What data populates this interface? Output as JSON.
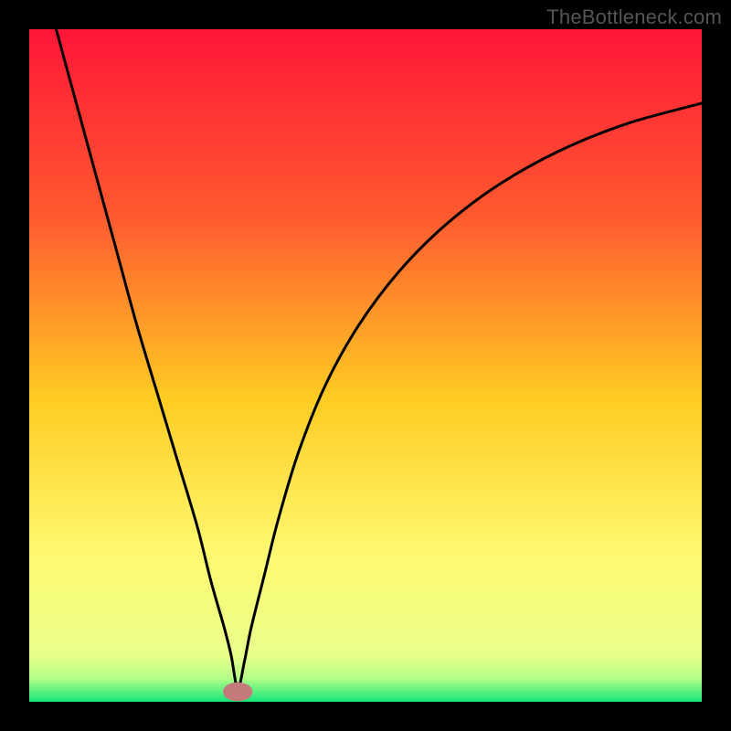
{
  "watermark": "TheBottleneck.com",
  "chart_data": {
    "type": "line",
    "title": "",
    "xlabel": "",
    "ylabel": "",
    "xlim": [
      0,
      100
    ],
    "ylim": [
      0,
      100
    ],
    "grid": false,
    "legend": false,
    "gradient_stops": [
      {
        "offset": 0,
        "color": "#ff1638"
      },
      {
        "offset": 0.28,
        "color": "#ff5a2f"
      },
      {
        "offset": 0.55,
        "color": "#ffcc22"
      },
      {
        "offset": 0.78,
        "color": "#fff970"
      },
      {
        "offset": 0.93,
        "color": "#eaff8a"
      },
      {
        "offset": 0.965,
        "color": "#b3ff88"
      },
      {
        "offset": 1.0,
        "color": "#15e77a"
      }
    ],
    "marker": {
      "x": 31,
      "y": 1.5,
      "rx": 2.2,
      "ry": 1.4,
      "color": "#c47a7a"
    },
    "series": [
      {
        "name": "curve",
        "x": [
          4.0,
          7,
          10,
          13,
          16,
          19,
          22,
          25,
          27,
          29,
          30,
          31,
          32,
          33,
          35,
          37,
          40,
          44,
          49,
          55,
          62,
          70,
          79,
          89,
          100
        ],
        "values": [
          100,
          89,
          78,
          67,
          56,
          46,
          36,
          26,
          18,
          11,
          7,
          2,
          6,
          11,
          19,
          27,
          37,
          47,
          56,
          64,
          71,
          77,
          82,
          86,
          89
        ]
      }
    ]
  }
}
